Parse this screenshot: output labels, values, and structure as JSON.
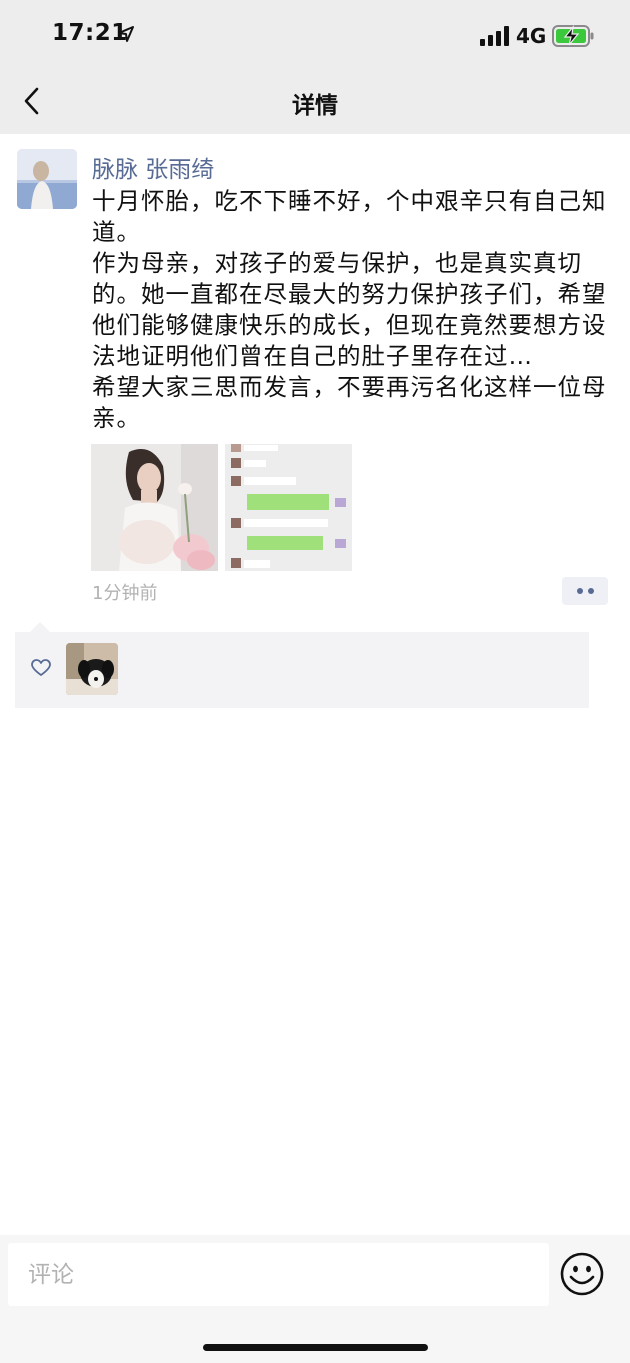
{
  "status_bar": {
    "time": "17:21",
    "network": "4G",
    "icons": [
      "location-arrow-icon",
      "cellular-signal-icon",
      "battery-charging-icon"
    ],
    "battery_color": "#3cc83c"
  },
  "nav": {
    "title": "详情",
    "back_icon": "chevron-left-icon"
  },
  "post": {
    "author": "脉脉 张雨绮",
    "text": "十月怀胎，吃不下睡不好，个中艰辛只有自己知道。\n作为母亲，对孩子的爱与保护，也是真实真切的。她一直都在尽最大的努力保护孩子们，希望他们能够健康快乐的成长，但现在竟然要想方设法地证明他们曾在自己的肚子里存在过…\n希望大家三思而发言，不要再污名化这样一位母亲。",
    "time_ago": "1分钟前",
    "images": [
      "pregnant-woman-photo",
      "chat-screenshot-photo"
    ],
    "more_icon": "more-dots-icon"
  },
  "likes": {
    "icon": "heart-icon",
    "liker_avatars": [
      "dog-avatar"
    ]
  },
  "comment_bar": {
    "placeholder": "评论",
    "value": "",
    "emoji_icon": "emoji-face-icon"
  },
  "colors": {
    "link_blue": "#576b95",
    "gray_text": "#b2b2b2",
    "nav_bg": "#ededed",
    "like_bg": "#f3f3f5"
  }
}
